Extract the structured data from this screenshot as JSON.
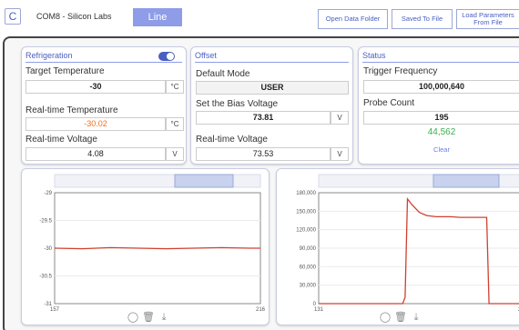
{
  "toolbar": {
    "refresh_glyph": "C",
    "port_label": "COM8 - Silicon Labs",
    "mode_tab": "Line",
    "open_folder": "Open Data Folder",
    "saved_to_file": "Saved To File",
    "load_params": "Load Parameters From File",
    "accent_color": "#8f9ce8"
  },
  "refrigeration": {
    "title": "Refrigeration",
    "toggle_on": true,
    "target_label": "Target Temperature",
    "target_value": "-30",
    "target_unit": "°C",
    "realtime_temp_label": "Real-time Temperature",
    "realtime_temp_value": "-30.02",
    "realtime_temp_unit": "°C",
    "realtime_temp_color": "#f07020",
    "realtime_voltage_label": "Real-time Voltage",
    "realtime_voltage_value": "4.08",
    "realtime_voltage_unit": "V"
  },
  "offset": {
    "title": "Offset",
    "default_mode_label": "Default Mode",
    "default_mode_value": "USER",
    "bias_label": "Set the Bias Voltage",
    "bias_value": "73.81",
    "bias_unit": "V",
    "realtime_voltage_label": "Real-time Voltage",
    "realtime_voltage_value": "73.53",
    "realtime_voltage_unit": "V"
  },
  "status": {
    "title": "Status",
    "trigger_label": "Trigger Frequency",
    "trigger_value": "100,000,640",
    "probe_label": "Probe Count",
    "probe_value": "195",
    "probe_secondary": "44,562",
    "probe_secondary_color": "#3cb050",
    "clear_label": "Clear"
  },
  "chart_data": [
    {
      "type": "line",
      "x_ticks": [
        "157",
        "216"
      ],
      "xlim": [
        157,
        216
      ],
      "y_ticks": [
        "-29",
        "-29.5",
        "-30",
        "-30.5",
        "-31"
      ],
      "ylim": [
        -31,
        -29
      ],
      "series": [
        {
          "color": "#d04030",
          "x": [
            157,
            165,
            173,
            181,
            189,
            197,
            205,
            213,
            216
          ],
          "values": [
            -30.0,
            -30.01,
            -29.99,
            -30.0,
            -30.01,
            -30.0,
            -29.99,
            -30.0,
            -30.0
          ]
        }
      ]
    },
    {
      "type": "line",
      "x_ticks": [
        "131",
        "216"
      ],
      "xlim": [
        131,
        216
      ],
      "y_ticks": [
        "180,000",
        "150,000",
        "120,000",
        "90,000",
        "60,000",
        "30,000",
        "0"
      ],
      "ylim": [
        0,
        180000
      ],
      "series": [
        {
          "color": "#d04030",
          "x": [
            131,
            150,
            166,
            167,
            168,
            170,
            173,
            176,
            180,
            186,
            190,
            195,
            200,
            201,
            202,
            216
          ],
          "values": [
            0,
            0,
            0,
            10000,
            170000,
            160000,
            148000,
            143000,
            141000,
            141000,
            140000,
            140000,
            140000,
            140000,
            0,
            0
          ]
        }
      ]
    }
  ],
  "chart_tools": {
    "reset_icon": "◯",
    "delete_icon": "🗑",
    "download_icon": "⤓"
  }
}
